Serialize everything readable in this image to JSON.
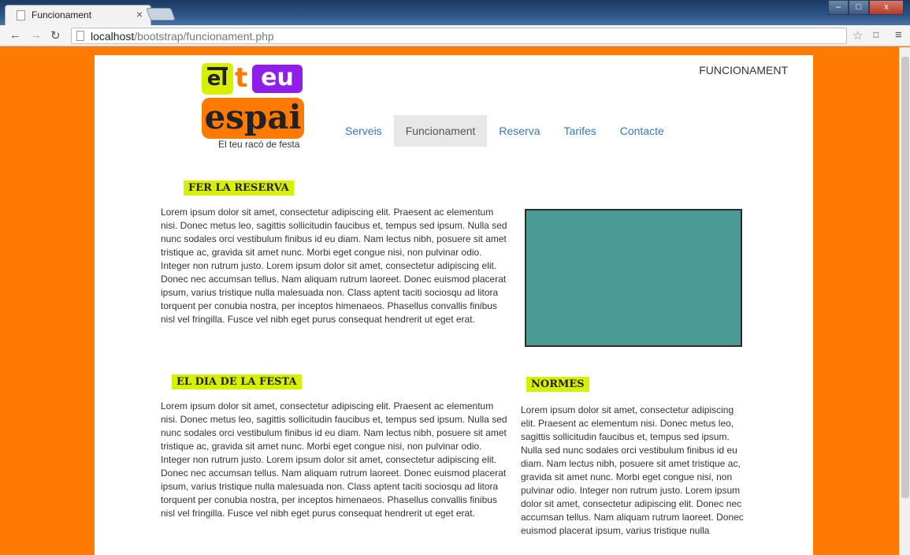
{
  "browser": {
    "tab_title": "Funcionament",
    "tab_close": "×",
    "url_host": "localhost",
    "url_path": "/bootstrap/funcionament.php"
  },
  "site": {
    "logo": {
      "el": "el",
      "t": "t",
      "eu": "eu",
      "espai": "espai"
    },
    "tagline": "El teu racó de festa",
    "page_label": "FUNCIONAMENT",
    "nav": [
      "Serveis",
      "Funcionament",
      "Reserva",
      "Tarifes",
      "Contacte"
    ],
    "active_nav": "Funcionament"
  },
  "sections": {
    "reserva": {
      "heading": "FER LA RESERVA",
      "text": "Lorem ipsum dolor sit amet, consectetur adipiscing elit. Praesent ac elementum nisi. Donec metus leo, sagittis sollicitudin faucibus et, tempus sed ipsum. Nulla sed nunc sodales orci vestibulum finibus id eu diam. Nam lectus nibh, posuere sit amet tristique ac, gravida sit amet nunc. Morbi eget congue nisi, non pulvinar odio. Integer non rutrum justo. Lorem ipsum dolor sit amet, consectetur adipiscing elit. Donec nec accumsan tellus. Nam aliquam rutrum laoreet. Donec euismod placerat ipsum, varius tristique nulla malesuada non. Class aptent taciti sociosqu ad litora torquent per conubia nostra, per inceptos himenaeos. Phasellus convallis finibus nisl vel fringilla. Fusce vel nibh eget purus consequat hendrerit ut eget erat."
    },
    "festa": {
      "heading": "EL DIA DE LA FESTA",
      "text": "Lorem ipsum dolor sit amet, consectetur adipiscing elit. Praesent ac elementum nisi. Donec metus leo, sagittis sollicitudin faucibus et, tempus sed ipsum. Nulla sed nunc sodales orci vestibulum finibus id eu diam. Nam lectus nibh, posuere sit amet tristique ac, gravida sit amet nunc. Morbi eget congue nisi, non pulvinar odio. Integer non rutrum justo. Lorem ipsum dolor sit amet, consectetur adipiscing elit. Donec nec accumsan tellus. Nam aliquam rutrum laoreet. Donec euismod placerat ipsum, varius tristique nulla malesuada non. Class aptent taciti sociosqu ad litora torquent per conubia nostra, per inceptos himenaeos. Phasellus convallis finibus nisl vel fringilla. Fusce vel nibh eget purus consequat hendrerit ut eget erat."
    },
    "normes": {
      "heading": "NORMES",
      "text": "Lorem ipsum dolor sit amet, consectetur adipiscing elit. Praesent ac elementum nisi. Donec metus leo, sagittis sollicitudin faucibus et, tempus sed ipsum. Nulla sed nunc sodales orci vestibulum finibus id eu diam. Nam lectus nibh, posuere sit amet tristique ac, gravida sit amet nunc. Morbi eget congue nisi, non pulvinar odio. Integer non rutrum justo. Lorem ipsum dolor sit amet, consectetur adipiscing elit. Donec nec accumsan tellus. Nam aliquam rutrum laoreet. Donec euismod placerat ipsum, varius tristique nulla"
    }
  },
  "colors": {
    "background": "#ff7a00",
    "highlight": "#d7f000",
    "logo_purple": "#8f1ee8",
    "placeholder": "#4a9a96",
    "link": "#3a78b8"
  }
}
